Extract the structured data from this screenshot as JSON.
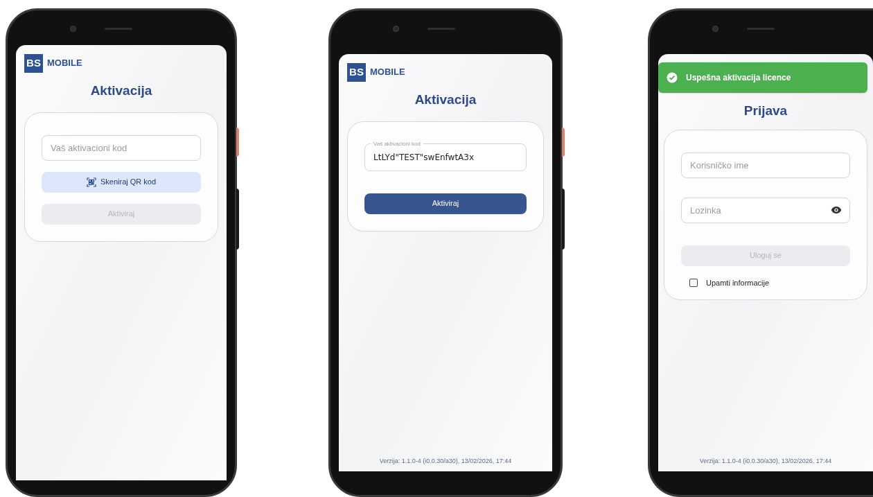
{
  "screens": [
    {
      "kind": "activation",
      "logo": {
        "mark": "BS",
        "text": "MOBILE"
      },
      "title": "Aktivacija",
      "code_field": {
        "placeholder": "Vaš aktivacioni kod"
      },
      "scan_button": {
        "label": "Skeniraj QR kod"
      },
      "activate_button": {
        "label": "Aktiviraj",
        "disabled": true
      }
    },
    {
      "kind": "activation",
      "logo": {
        "mark": "BS",
        "text": "MOBILE"
      },
      "title": "Aktivacija",
      "code_field": {
        "label": "Vaš aktivacioni kod",
        "value": "LtLYd\"TEST\"swEnfwtA3x"
      },
      "activate_button": {
        "label": "Aktiviraj",
        "disabled": false
      },
      "version": "Verzija: 1.1.0-4 (i0.0.30/a30), 13/02/2026, 17:44"
    },
    {
      "kind": "login",
      "toast": {
        "text": "Uspešna aktivacija licence"
      },
      "title": "Prijava",
      "username_field": {
        "placeholder": "Korisničko ime"
      },
      "password_field": {
        "placeholder": "Lozinka"
      },
      "login_button": {
        "label": "Uloguj se",
        "disabled": true
      },
      "remember": {
        "label": "Upamti informacije",
        "checked": false
      },
      "version": "Verzija: 1.1.0-4 (i0.0.30/a30), 13/02/2026, 17:44"
    }
  ]
}
